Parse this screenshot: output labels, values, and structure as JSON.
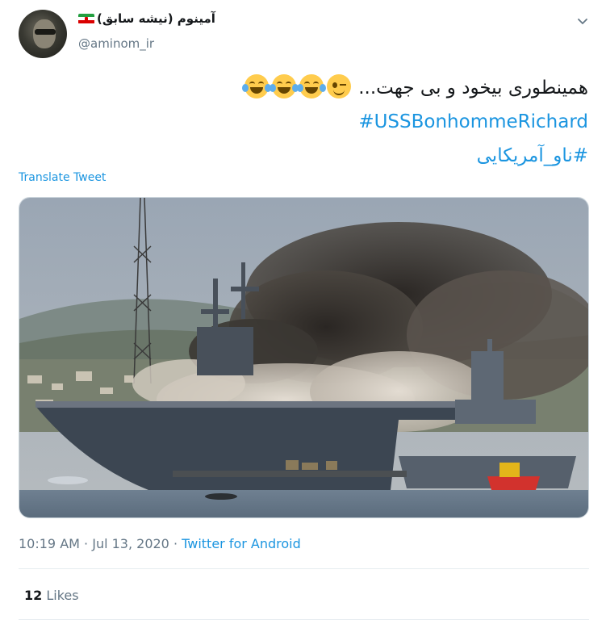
{
  "user": {
    "display_name": "آمینوم (نیشه سابق)",
    "handle": "@aminom_ir",
    "flag_icon": "iran-flag-icon"
  },
  "tweet": {
    "text_line1": "همینطوری بیخود و بی جهت...",
    "hashtag1": "#USSBonhommeRichard",
    "hashtag2": "#ناو_آمریکایی",
    "emojis": [
      "face-with-tears-of-joy-icon",
      "face-with-tears-of-joy-icon",
      "face-with-tears-of-joy-icon",
      "winking-face-icon"
    ]
  },
  "translate_label": "Translate Tweet",
  "meta": {
    "time": "10:19 AM",
    "separator": " · ",
    "date": "Jul 13, 2020",
    "source": "Twitter for Android"
  },
  "stats": {
    "likes_count": "12",
    "likes_label": "Likes"
  },
  "colors": {
    "link": "#1b95e0",
    "secondary_text": "#657786",
    "divider": "#e6ecf0"
  }
}
